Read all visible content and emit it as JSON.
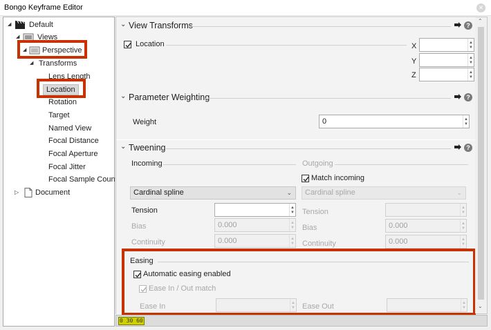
{
  "window": {
    "title": "Bongo Keyframe Editor",
    "close_glyph": "✕"
  },
  "tree": {
    "items": [
      {
        "label": "Default",
        "icon": "clapper-icon",
        "expander": "◢"
      },
      {
        "label": "Views",
        "icon": "views-icon",
        "expander": "◢"
      },
      {
        "label": "Perspective",
        "icon": "view-icon",
        "expander": "◢"
      },
      {
        "label": "Transforms",
        "expander": "◢"
      },
      {
        "label": "Lens Length"
      },
      {
        "label": "Location"
      },
      {
        "label": "Rotation"
      },
      {
        "label": "Target"
      },
      {
        "label": "Named View"
      },
      {
        "label": "Focal Distance"
      },
      {
        "label": "Focal Aperture"
      },
      {
        "label": "Focal Jitter"
      },
      {
        "label": "Focal Sample Count"
      },
      {
        "label": "Document",
        "icon": "document-icon",
        "expander": "▷"
      }
    ]
  },
  "view_transforms": {
    "title": "View Transforms",
    "location_label": "Location",
    "location_checked": true,
    "x_label": "X",
    "y_label": "Y",
    "z_label": "Z",
    "x_value": "",
    "y_value": "",
    "z_value": ""
  },
  "parameter_weighting": {
    "title": "Parameter Weighting",
    "weight_label": "Weight",
    "weight_value": "0"
  },
  "tweening": {
    "title": "Tweening",
    "incoming_label": "Incoming",
    "outgoing_label": "Outgoing",
    "match_incoming_label": "Match incoming",
    "match_incoming_checked": true,
    "incoming_interp": "Cardinal spline",
    "outgoing_interp": "Cardinal spline",
    "tension_label": "Tension",
    "bias_label": "Bias",
    "continuity_label": "Continuity",
    "in_tension": "",
    "in_bias": "0.000",
    "in_continuity": "0.000",
    "out_tension": "",
    "out_bias": "0.000",
    "out_continuity": "0.000"
  },
  "easing": {
    "title": "Easing",
    "auto_label": "Automatic easing enabled",
    "auto_checked": true,
    "match_label": "Ease In / Out match",
    "match_checked": true,
    "ease_in_label": "Ease In",
    "ease_out_label": "Ease Out",
    "ease_in_value": "",
    "ease_out_value": ""
  },
  "status": {
    "frame_badge": "0 30 60"
  },
  "colors": {
    "highlight": "#c83200",
    "panel_bg": "#f3f3f3"
  }
}
